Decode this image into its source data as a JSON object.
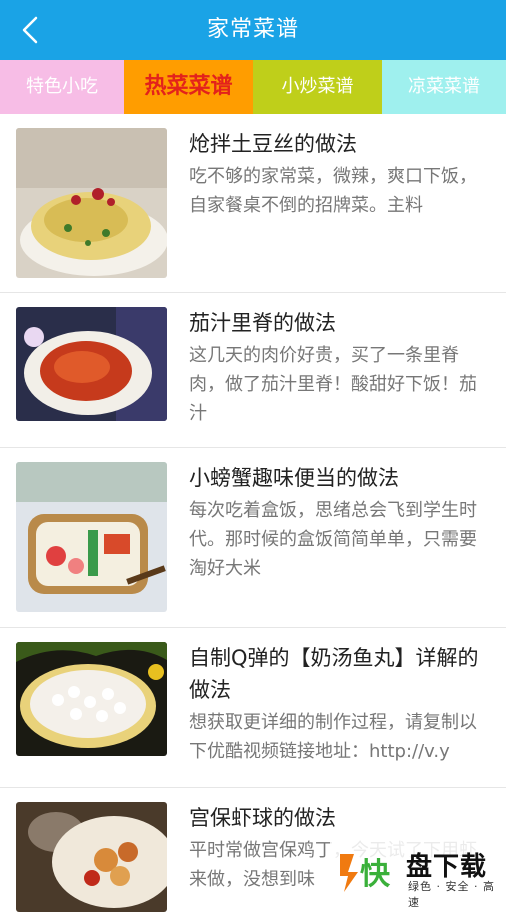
{
  "header": {
    "title": "家常菜谱",
    "back_icon": "chevron-left-icon",
    "background": "#1aa3e6"
  },
  "tabs": [
    {
      "label": "特色小吃",
      "color": "#f7bde6"
    },
    {
      "label": "热菜菜谱",
      "color": "#ff9d00",
      "selected": true
    },
    {
      "label": "小炒菜谱",
      "color": "#bfcf1a"
    },
    {
      "label": "凉菜菜谱",
      "color": "#9ff0ee"
    }
  ],
  "recipes": [
    {
      "title": "炝拌土豆丝的做法",
      "desc": "吃不够的家常菜，微辣，爽口下饭，自家餐桌不倒的招牌菜。主料"
    },
    {
      "title": "茄汁里脊的做法",
      "desc": "这几天的肉价好贵，买了一条里脊肉，做了茄汁里脊！酸甜好下饭！茄汁"
    },
    {
      "title": "小螃蟹趣味便当的做法",
      "desc": "每次吃着盒饭，思绪总会飞到学生时代。那时候的盒饭简简单单，只需要淘好大米"
    },
    {
      "title": "自制Q弹的【奶汤鱼丸】详解的做法",
      "desc": "想获取更详细的制作过程，请复制以下优酷视频链接地址：http://v.y"
    },
    {
      "title": "宫保虾球的做法",
      "desc": "平时常做宫保鸡丁，今天试了下用虾来做，没想到味"
    }
  ],
  "watermark": {
    "name": "盘下载",
    "sub": "绿色 · 安全 · 高速",
    "logo_char": "快"
  }
}
